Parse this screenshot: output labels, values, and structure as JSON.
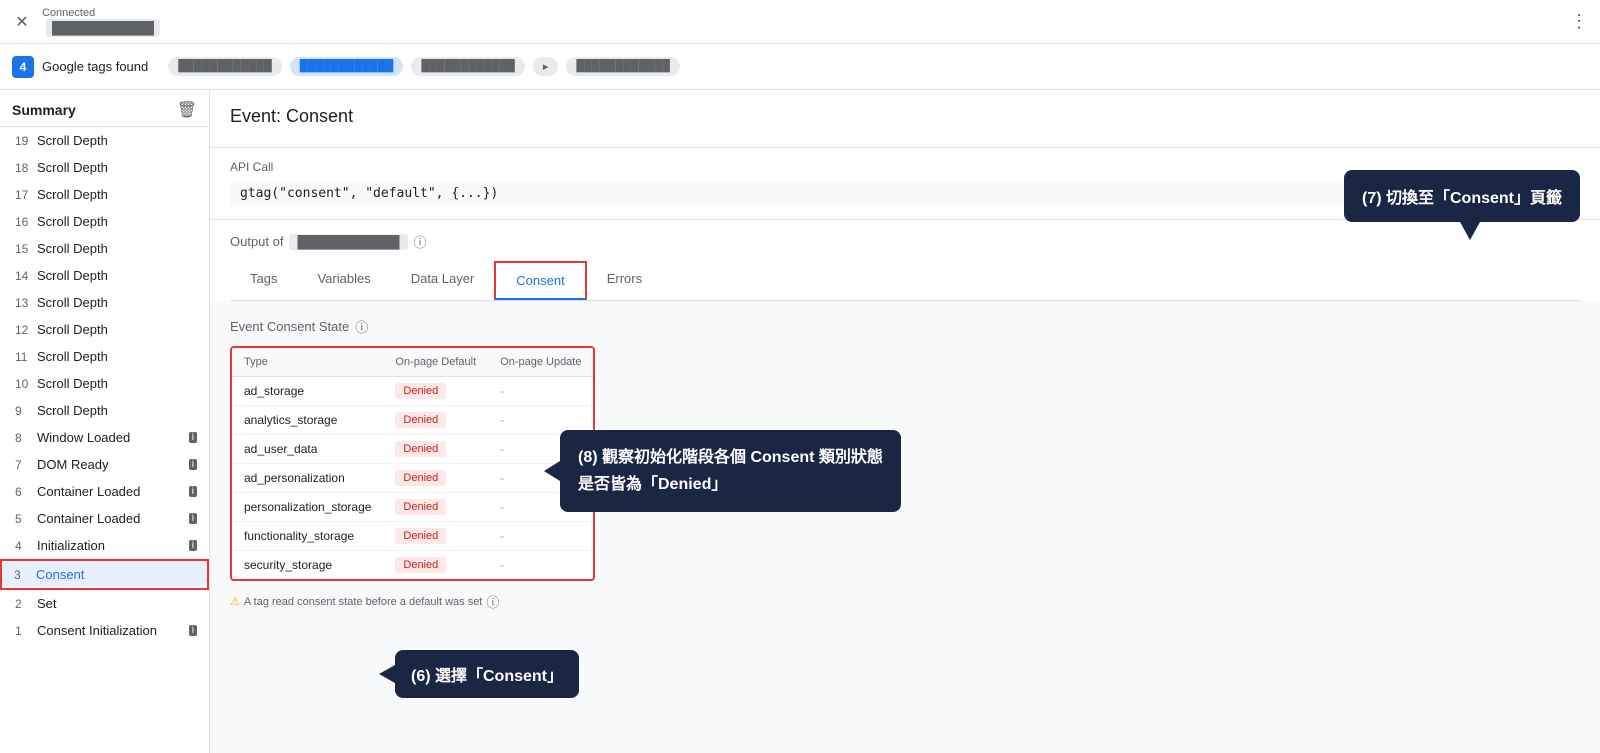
{
  "topbar": {
    "close_icon": "✕",
    "status": "Connected",
    "url_blurred": "████████████",
    "more_icon": "⋮"
  },
  "tagbar": {
    "count": "4",
    "found_label": "Google tags found",
    "tabs": [
      {
        "label": "████████████",
        "active": false
      },
      {
        "label": "████████████",
        "active": true
      },
      {
        "label": "████████████",
        "active": false
      },
      {
        "label": "▸",
        "active": false
      },
      {
        "label": "████████████",
        "active": false
      }
    ]
  },
  "sidebar": {
    "title": "Summary",
    "trash_icon": "🗑",
    "items": [
      {
        "num": "19",
        "label": "Scroll Depth",
        "icon": null,
        "active": false
      },
      {
        "num": "18",
        "label": "Scroll Depth",
        "icon": null,
        "active": false
      },
      {
        "num": "17",
        "label": "Scroll Depth",
        "icon": null,
        "active": false
      },
      {
        "num": "16",
        "label": "Scroll Depth",
        "icon": null,
        "active": false
      },
      {
        "num": "15",
        "label": "Scroll Depth",
        "icon": null,
        "active": false
      },
      {
        "num": "14",
        "label": "Scroll Depth",
        "icon": null,
        "active": false
      },
      {
        "num": "13",
        "label": "Scroll Depth",
        "icon": null,
        "active": false
      },
      {
        "num": "12",
        "label": "Scroll Depth",
        "icon": null,
        "active": false
      },
      {
        "num": "11",
        "label": "Scroll Depth",
        "icon": null,
        "active": false
      },
      {
        "num": "10",
        "label": "Scroll Depth",
        "icon": null,
        "active": false
      },
      {
        "num": "9",
        "label": "Scroll Depth",
        "icon": null,
        "active": false
      },
      {
        "num": "8",
        "label": "Window Loaded",
        "icon": "i",
        "active": false
      },
      {
        "num": "7",
        "label": "DOM Ready",
        "icon": "i",
        "active": false
      },
      {
        "num": "6",
        "label": "Container Loaded",
        "icon": "i",
        "active": false
      },
      {
        "num": "5",
        "label": "Container Loaded",
        "icon": "i",
        "active": false
      },
      {
        "num": "4",
        "label": "Initialization",
        "icon": "i",
        "active": false
      },
      {
        "num": "3",
        "label": "Consent",
        "icon": null,
        "active": true
      },
      {
        "num": "2",
        "label": "Set",
        "icon": null,
        "active": false
      },
      {
        "num": "1",
        "label": "Consent Initialization",
        "icon": "i",
        "active": false
      }
    ]
  },
  "main": {
    "event_title": "Event: Consent",
    "api_call_label": "API Call",
    "api_call_code": "gtag(\"consent\", \"default\", {...})",
    "output_label": "Output of",
    "output_url": "████████████",
    "help_icon": "?",
    "sub_tabs": [
      {
        "label": "Tags",
        "active": false
      },
      {
        "label": "Variables",
        "active": false
      },
      {
        "label": "Data Layer",
        "active": false
      },
      {
        "label": "Consent",
        "active": true
      },
      {
        "label": "Errors",
        "active": false
      }
    ],
    "consent_state_title": "Event Consent State",
    "consent_table": {
      "headers": [
        "Type",
        "On-page Default",
        "On-page Update"
      ],
      "rows": [
        {
          "type": "ad_storage",
          "default": "Denied",
          "update": "-"
        },
        {
          "type": "analytics_storage",
          "default": "Denied",
          "update": "-"
        },
        {
          "type": "ad_user_data",
          "default": "Denied",
          "update": "-"
        },
        {
          "type": "ad_personalization",
          "default": "Denied",
          "update": "-"
        },
        {
          "type": "personalization_storage",
          "default": "Denied",
          "update": "-"
        },
        {
          "type": "functionality_storage",
          "default": "Denied",
          "update": "-"
        },
        {
          "type": "security_storage",
          "default": "Denied",
          "update": "-"
        }
      ]
    },
    "footnote": "A tag read consent state before a default was set"
  },
  "annotations": {
    "bubble1": "(7) 切換至「Consent」頁籤",
    "bubble2_line1": "(8) 觀察初始化階段各個 Consent 類別狀態",
    "bubble2_line2": "是否皆為「Denied」",
    "bubble3": "(6) 選擇「Consent」"
  }
}
